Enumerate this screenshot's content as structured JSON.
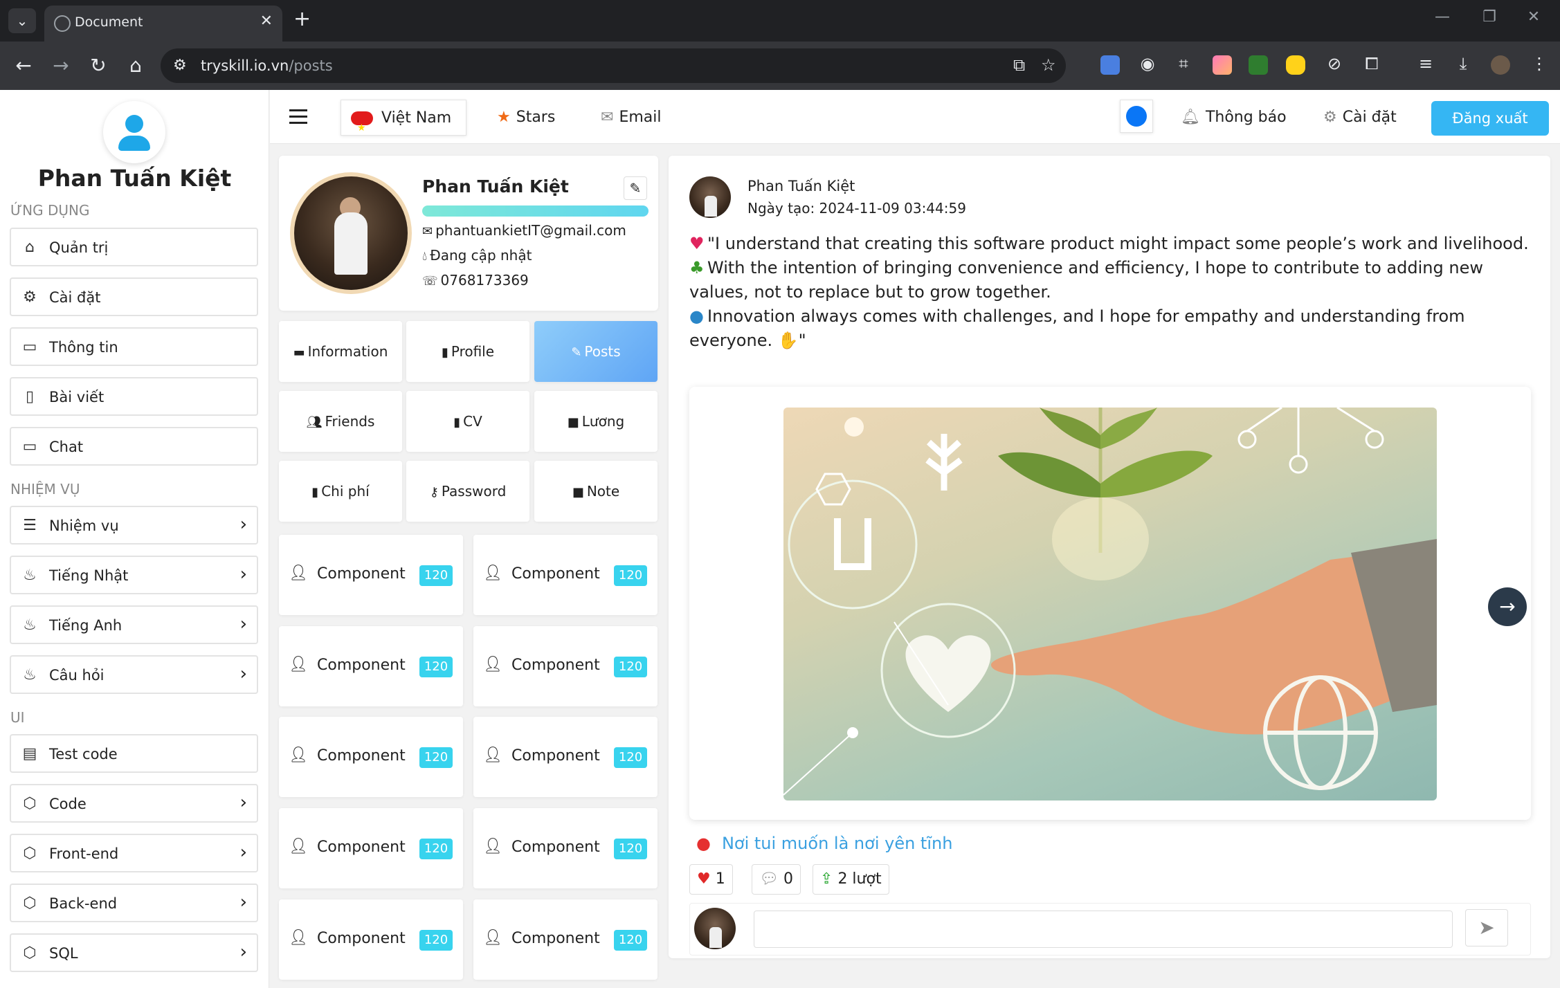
{
  "browser": {
    "tab_title": "Document",
    "url_host": "tryskill.io.vn",
    "url_path": "/posts"
  },
  "sidebar": {
    "user_name": "Phan Tuấn Kiệt",
    "sections": {
      "apps": "ỨNG DỤNG",
      "tasks": "NHIỆM VỤ",
      "ui": "UI"
    },
    "apps_items": [
      {
        "label": "Quản trị",
        "icon": "home-icon"
      },
      {
        "label": "Cài đặt",
        "icon": "gear-icon"
      },
      {
        "label": "Thông tin",
        "icon": "comment-icon"
      },
      {
        "label": "Bài viết",
        "icon": "file-icon"
      },
      {
        "label": "Chat",
        "icon": "comment-icon"
      }
    ],
    "task_items": [
      {
        "label": "Nhiệm vụ",
        "icon": "layers-icon"
      },
      {
        "label": "Tiếng Nhật",
        "icon": "fire-icon"
      },
      {
        "label": "Tiếng Anh",
        "icon": "fire-icon"
      },
      {
        "label": "Câu hỏi",
        "icon": "fire-icon"
      }
    ],
    "ui_items": [
      {
        "label": "Test code",
        "icon": "inbox-icon"
      },
      {
        "label": "Code",
        "icon": "codepen-icon"
      },
      {
        "label": "Front-end",
        "icon": "codepen-icon"
      },
      {
        "label": "Back-end",
        "icon": "codepen-icon"
      },
      {
        "label": "SQL",
        "icon": "codepen-icon"
      }
    ]
  },
  "topbar": {
    "language": "Việt Nam",
    "stars": "Stars",
    "email": "Email",
    "notifications": "Thông báo",
    "settings": "Cài đặt",
    "logout": "Đăng xuất"
  },
  "profile": {
    "name": "Phan Tuấn Kiệt",
    "email": "phantuankietIT@gmail.com",
    "address": "Đang cập nhật",
    "phone": "0768173369"
  },
  "nav_grid": [
    {
      "label": "Information",
      "icon": "comment-icon"
    },
    {
      "label": "Profile",
      "icon": "id-badge-icon"
    },
    {
      "label": "Posts",
      "icon": "edit-icon",
      "active": true
    },
    {
      "label": "Friends",
      "icon": "users-icon"
    },
    {
      "label": "CV",
      "icon": "file-icon"
    },
    {
      "label": "Lương",
      "icon": "sticky-note-icon"
    },
    {
      "label": "Chi phí",
      "icon": "file-icon"
    },
    {
      "label": "Password",
      "icon": "key-icon"
    },
    {
      "label": "Note",
      "icon": "sticky-note-icon"
    }
  ],
  "components": {
    "label": "Component",
    "badge": "120",
    "count": 10
  },
  "post": {
    "author": "Phan Tuấn Kiệt",
    "created": "Ngày tạo: 2024-11-09 03:44:59",
    "line1": "\"I understand that creating this software product might impact some people’s work and livelihood.",
    "line2": "With the intention of bringing convenience and efficiency, I hope to contribute to adding new values, not to replace but to grow together.",
    "line3": "Innovation always comes with challenges, and I hope for empathy and understanding from everyone.",
    "line3_end": "\"",
    "location": "Nơi tui muốn là nơi yên tĩnh",
    "likes": "1",
    "comments": "0",
    "shares": "2 lượt",
    "comment_placeholder": ""
  },
  "colors": {
    "accent": "#35b6f3",
    "badge": "#38d3ee",
    "active_nav": "#5fa5f5",
    "location_text": "#3aa0e0"
  }
}
